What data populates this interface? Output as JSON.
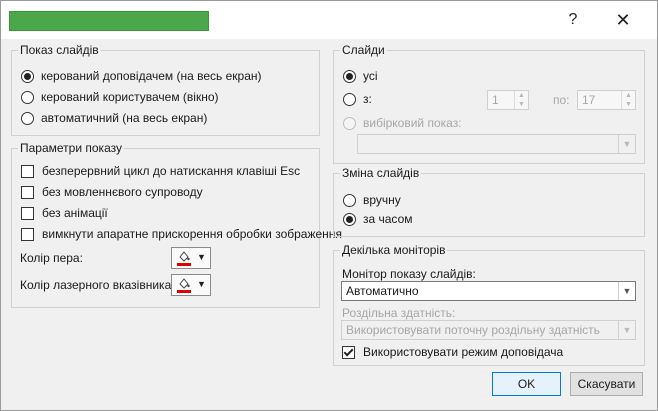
{
  "window": {
    "help_label": "?",
    "close_label": "✕",
    "title_bar_color": "#4aa84a"
  },
  "show_type": {
    "title": "Показ слайдів",
    "options": [
      {
        "label": "керований доповідачем (на весь екран)",
        "selected": true
      },
      {
        "label": "керований користувачем (вікно)",
        "selected": false
      },
      {
        "label": "автоматичний (на весь екран)",
        "selected": false
      }
    ]
  },
  "show_options": {
    "title": "Параметри показу",
    "checks": [
      {
        "label": "безперервний цикл до натискання клавіші Esc",
        "checked": false
      },
      {
        "label": "без мовленнєвого супроводу",
        "checked": false
      },
      {
        "label": "без анімації",
        "checked": false
      },
      {
        "label": "вимкнути апаратне прискорення обробки зображення",
        "checked": false
      }
    ],
    "pen_color_label": "Колір пера:",
    "laser_color_label": "Колір лазерного вказівника:",
    "pen_color": "#e00000",
    "laser_color": "#e00000"
  },
  "slides": {
    "title": "Слайди",
    "all_label": "усі",
    "from_label": "з:",
    "from_value": "1",
    "to_label": "по:",
    "to_value": "17",
    "custom_label": "вибірковий показ:",
    "custom_value": ""
  },
  "advance": {
    "title": "Зміна слайдів",
    "manual_label": "вручну",
    "timings_label": "за часом"
  },
  "monitors": {
    "title": "Декілька моніторів",
    "monitor_label": "Монітор показу слайдів:",
    "monitor_value": "Автоматично",
    "resolution_label": "Роздільна здатність:",
    "resolution_value": "Використовувати поточну роздільну здатність",
    "presenter_view_label": "Використовувати режим доповідача",
    "presenter_view_checked": true
  },
  "buttons": {
    "ok": "OK",
    "cancel": "Скасувати"
  }
}
